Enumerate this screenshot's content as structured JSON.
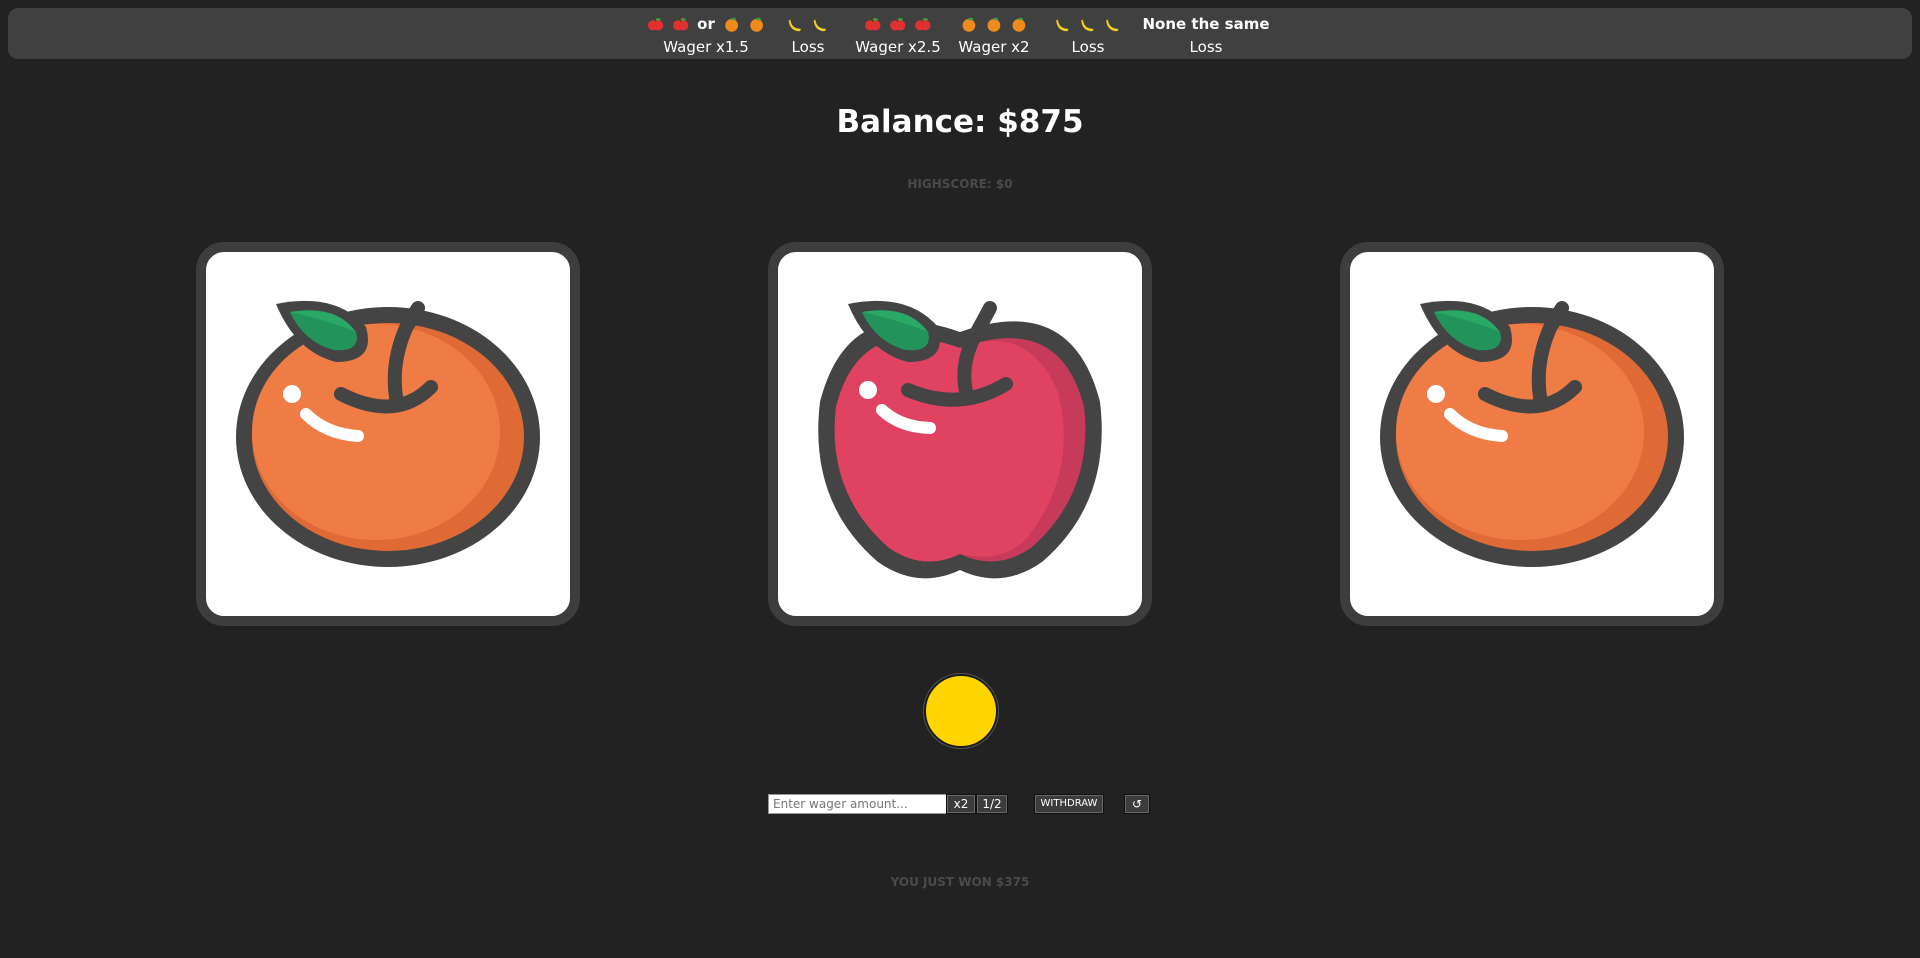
{
  "paytable": {
    "columns": [
      {
        "symbols": [
          "apple-icon",
          "apple-icon",
          "or",
          "orange-icon",
          "orange-icon"
        ],
        "label": "Wager x1.5"
      },
      {
        "symbols": [
          "banana-icon",
          "banana-icon"
        ],
        "label": "Loss"
      },
      {
        "symbols": [
          "apple-icon",
          "apple-icon",
          "apple-icon"
        ],
        "label": "Wager x2.5"
      },
      {
        "symbols": [
          "orange-icon",
          "orange-icon",
          "orange-icon"
        ],
        "label": "Wager x2"
      },
      {
        "symbols": [
          "banana-icon",
          "banana-icon",
          "banana-icon"
        ],
        "label": "Loss"
      },
      {
        "symbols": [
          "None the same"
        ],
        "label": "Loss"
      }
    ],
    "or_text": "or",
    "none_same_text": "None the same"
  },
  "balance_text": "Balance: $875",
  "highscore_text": "HIGHSCORE: $0",
  "reels": [
    "orange-icon",
    "apple-icon",
    "orange-icon"
  ],
  "spin_button_color": "#ffd500",
  "controls": {
    "wager_placeholder": "Enter wager amount...",
    "wager_value": "",
    "double_label": "x2",
    "half_label": "1/2",
    "withdraw_label": "WITHDRAW",
    "reset_label": "↺"
  },
  "result_text": "YOU JUST WON $375",
  "colors": {
    "background": "#222222",
    "paytable_bg": "#404040",
    "slot_border": "#3d3d3d",
    "orange": "#f07c45",
    "apple": "#e04262",
    "leaf": "#2aa866",
    "outline": "#444444"
  }
}
